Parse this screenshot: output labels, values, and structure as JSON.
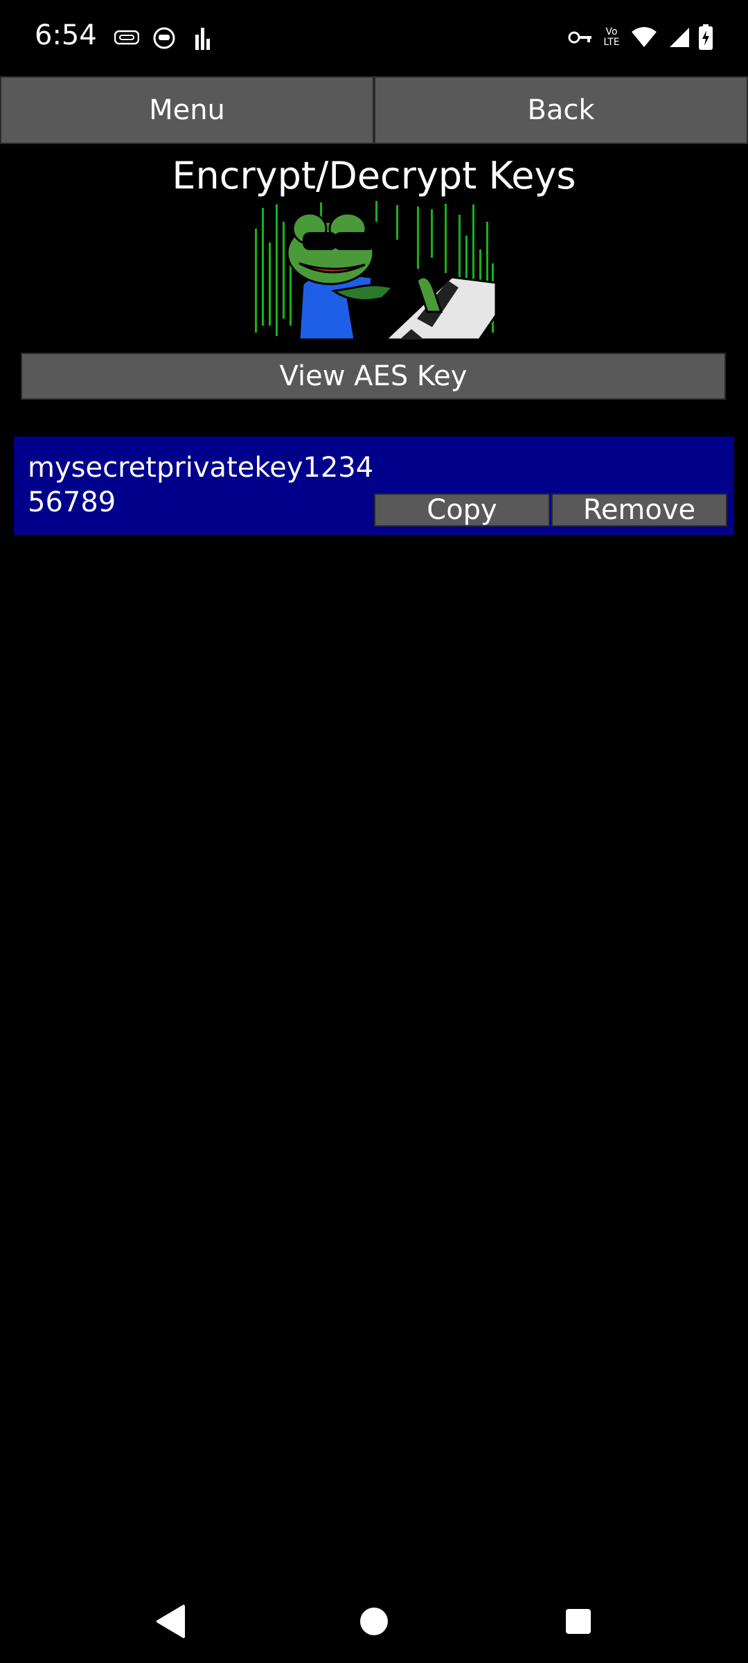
{
  "status_bar": {
    "time": "6:54",
    "left_icons": [
      "vpn-badge-icon",
      "cat-face-icon",
      "bar-chart-icon"
    ],
    "right_icons": [
      "key-icon",
      "volte-icon",
      "wifi-icon",
      "signal-icon",
      "battery-charging-icon"
    ],
    "volte_text": "Vo LTE"
  },
  "top_buttons": {
    "menu": "Menu",
    "back": "Back"
  },
  "title": "Encrypt/Decrypt Keys",
  "view_aes": "View AES Key",
  "key_card": {
    "key_value": "mysecretprivatekey123456789",
    "copy": "Copy",
    "remove": "Remove",
    "background": "#00008b"
  },
  "nav_bar": {
    "icons": [
      "back-triangle-icon",
      "home-circle-icon",
      "recents-square-icon"
    ]
  },
  "colors": {
    "button": "#595959",
    "background": "#000000"
  }
}
